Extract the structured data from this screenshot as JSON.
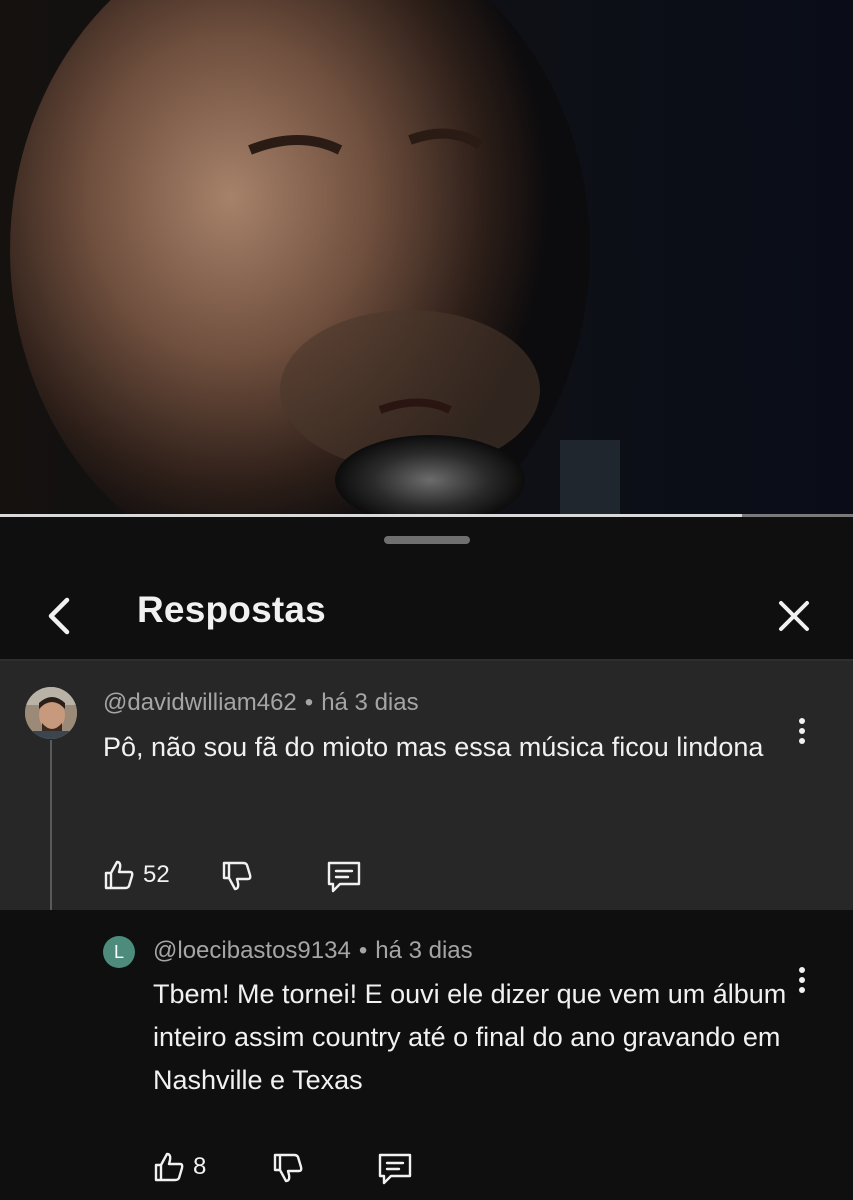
{
  "video": {
    "progress_fraction": 0.87
  },
  "sheet": {
    "title": "Respostas"
  },
  "icons": {
    "back": "chevron-left-icon",
    "close": "close-icon",
    "more": "more-vertical-icon",
    "like": "thumbs-up-icon",
    "dislike": "thumbs-down-icon",
    "reply": "comment-icon"
  },
  "comments": [
    {
      "author": "@davidwilliam462",
      "separator": "•",
      "time": "há 3 dias",
      "text": "Pô, não sou fã do mioto mas essa música ficou lindona",
      "likes": "52"
    },
    {
      "avatar_letter": "L",
      "author": "@loecibastos9134",
      "separator": "•",
      "time": "há 3 dias",
      "text": "Tbem! Me tornei! E ouvi ele dizer que vem um álbum inteiro assim country até o final do ano gravando em Nashville e Texas",
      "likes": "8"
    }
  ],
  "colors": {
    "background": "#0f0f0f",
    "highlight_comment": "#272727",
    "avatar_letter_bg": "#4d8c7c"
  }
}
